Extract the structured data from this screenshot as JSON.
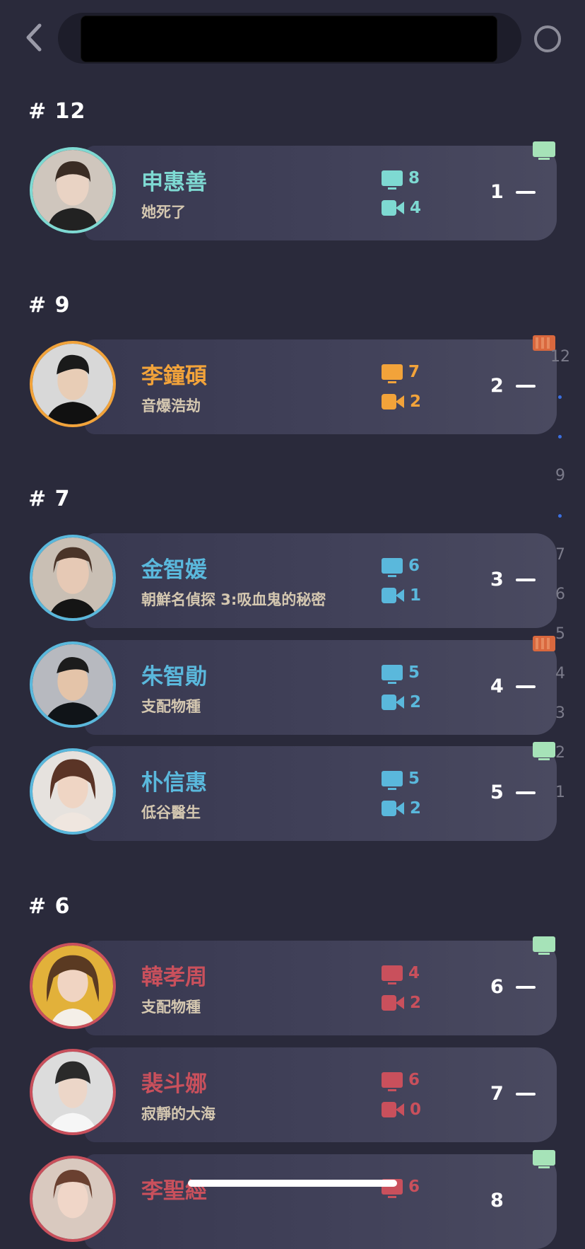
{
  "header": {
    "back_icon": "chevron-left-icon",
    "search_value": "",
    "right_icon": "circle-icon"
  },
  "colors": {
    "bg": "#2a2a3b",
    "teal": "#7ed9d2",
    "orange": "#f2a33a",
    "blue": "#5ab8dc",
    "red": "#c9505c",
    "tv_badge": "#a6e3b8",
    "film_badge": "#d9683e"
  },
  "groups": [
    {
      "label": "# 12"
    },
    {
      "label": "# 9"
    },
    {
      "label": "# 7"
    },
    {
      "label": "# 6"
    }
  ],
  "rows": [
    {
      "name": "申惠善",
      "work": "她死了",
      "tv": "8",
      "movie": "4",
      "rank": "1",
      "badge": "tv-icon"
    },
    {
      "name": "李鐘碩",
      "work": "音爆浩劫",
      "tv": "7",
      "movie": "2",
      "rank": "2",
      "badge": "film-icon"
    },
    {
      "name": "金智媛",
      "work": "朝鮮名偵探 3:吸血鬼的秘密",
      "tv": "6",
      "movie": "1",
      "rank": "3",
      "badge": ""
    },
    {
      "name": "朱智勛",
      "work": "支配物種",
      "tv": "5",
      "movie": "2",
      "rank": "4",
      "badge": "film-icon"
    },
    {
      "name": "朴信惠",
      "work": "低谷醫生",
      "tv": "5",
      "movie": "2",
      "rank": "5",
      "badge": "tv-icon"
    },
    {
      "name": "韓孝周",
      "work": "支配物種",
      "tv": "4",
      "movie": "2",
      "rank": "6",
      "badge": "tv-icon"
    },
    {
      "name": "裴斗娜",
      "work": "寂靜的大海",
      "tv": "6",
      "movie": "0",
      "rank": "7",
      "badge": ""
    },
    {
      "name": "李聖經",
      "work": "",
      "tv": "6",
      "movie": "",
      "rank": "8",
      "badge": "tv-icon"
    }
  ],
  "index_bar": [
    "12",
    "9",
    "7",
    "6",
    "5",
    "4",
    "3",
    "2",
    "1"
  ]
}
